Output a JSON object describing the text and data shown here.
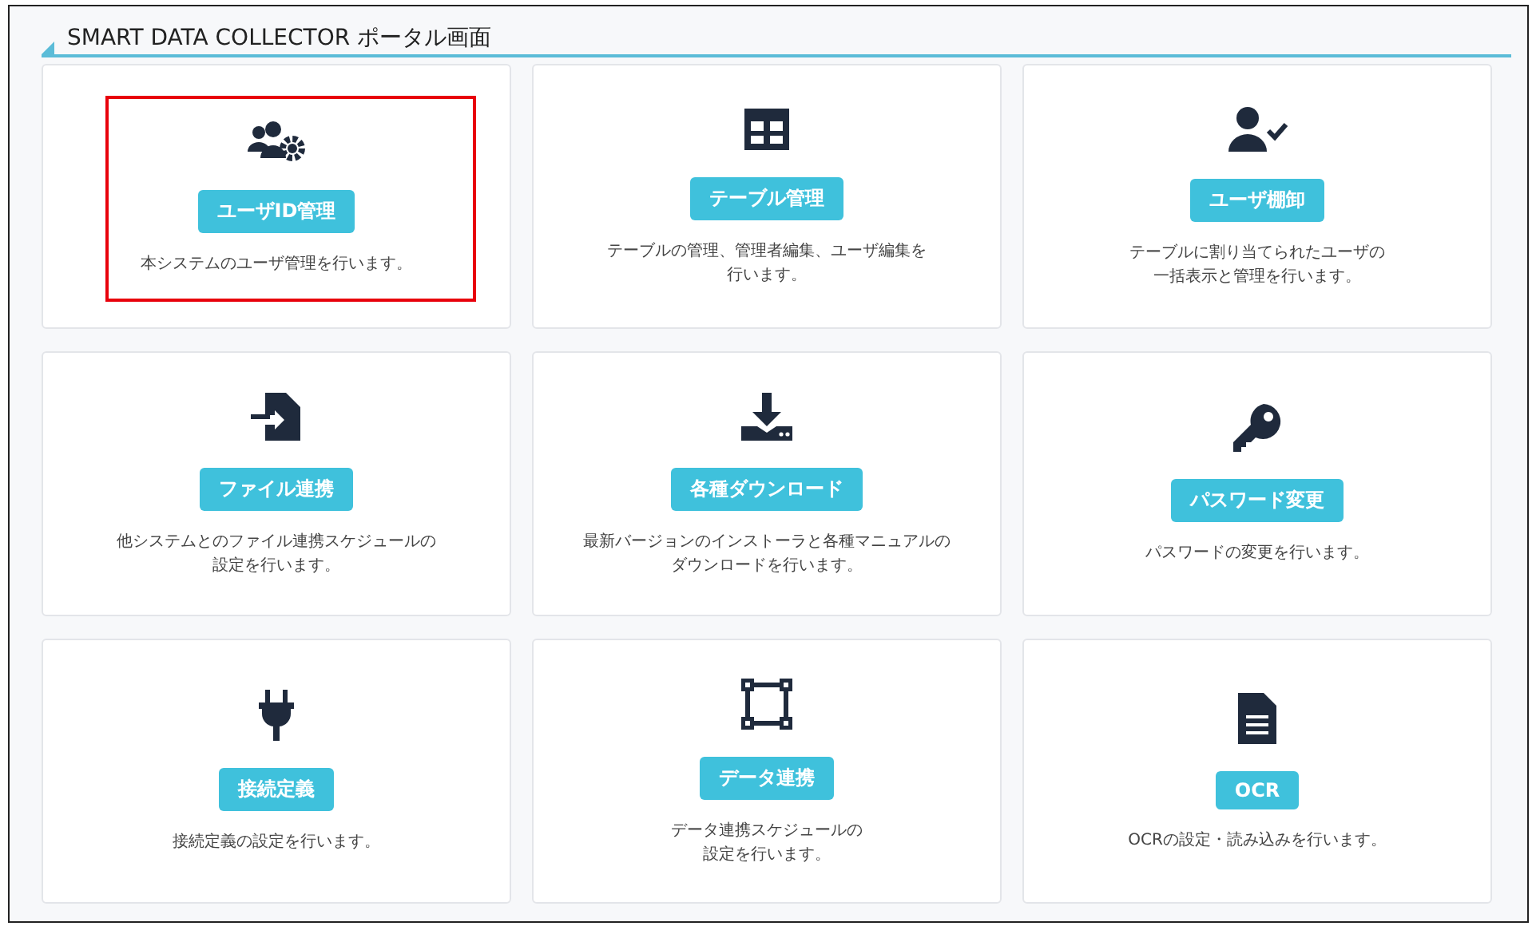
{
  "header": {
    "title": "SMART DATA COLLECTOR ポータル画面"
  },
  "cards": [
    {
      "button": "ユーザID管理",
      "description": [
        "本システムのユーザ管理を行います。"
      ],
      "highlighted": true
    },
    {
      "button": "テーブル管理",
      "description": [
        "テーブルの管理、管理者編集、ユーザ編集を",
        "行います。"
      ],
      "highlighted": false
    },
    {
      "button": "ユーザ棚卸",
      "description": [
        "テーブルに割り当てられたユーザの",
        "一括表示と管理を行います。"
      ],
      "highlighted": false
    },
    {
      "button": "ファイル連携",
      "description": [
        "他システムとのファイル連携スケジュールの",
        "設定を行います。"
      ],
      "highlighted": false
    },
    {
      "button": "各種ダウンロード",
      "description": [
        "最新バージョンのインストーラと各種マニュアルの",
        "ダウンロードを行います。"
      ],
      "highlighted": false
    },
    {
      "button": "パスワード変更",
      "description": [
        "パスワードの変更を行います。"
      ],
      "highlighted": false
    },
    {
      "button": "接続定義",
      "description": [
        "接続定義の設定を行います。"
      ],
      "highlighted": false
    },
    {
      "button": "データ連携",
      "description": [
        "データ連携スケジュールの",
        "設定を行います。"
      ],
      "highlighted": false
    },
    {
      "button": "OCR",
      "description": [
        "OCRの設定・読み込みを行います。"
      ],
      "highlighted": false
    }
  ]
}
